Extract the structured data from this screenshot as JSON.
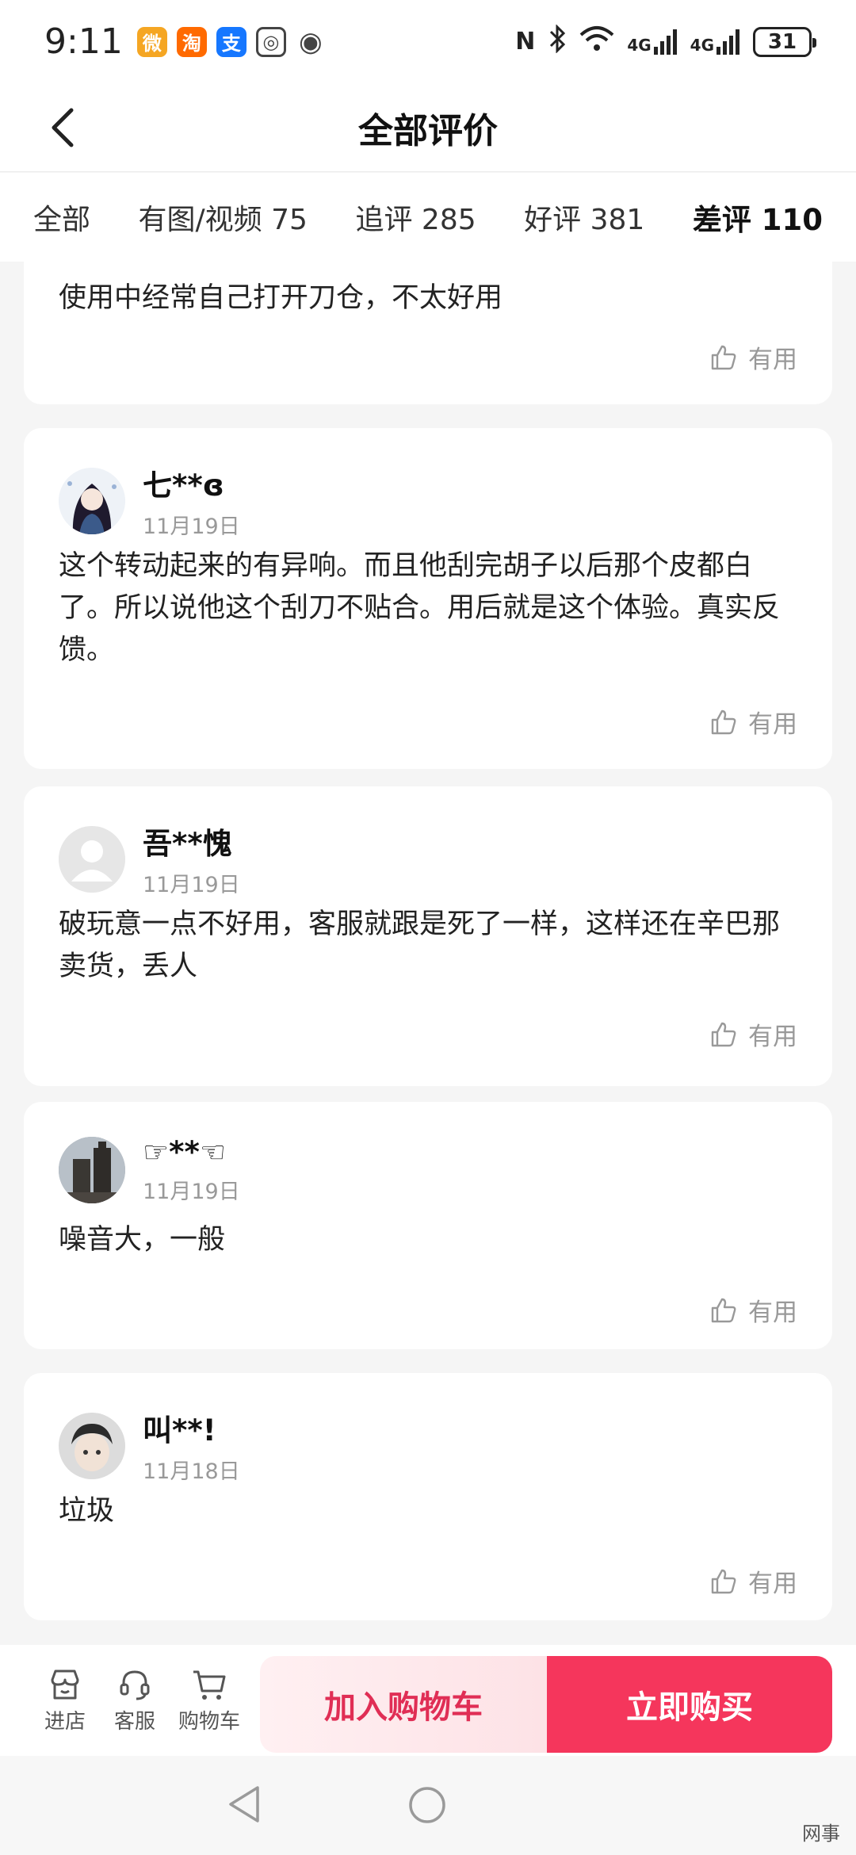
{
  "status_bar": {
    "time": "9:11",
    "apps": [
      {
        "icon": "weibo-icon",
        "color": "#f5a623",
        "glyph": "微"
      },
      {
        "icon": "taobao-icon",
        "color": "#ff6a00",
        "glyph": "淘"
      },
      {
        "icon": "alipay-icon",
        "color": "#1677ff",
        "glyph": "支"
      },
      {
        "icon": "cloud-icon",
        "color": "#444444",
        "glyph": "◎"
      },
      {
        "icon": "eye-icon",
        "color": "#444444",
        "glyph": "◉"
      }
    ],
    "nfc": "N",
    "network1": "4G",
    "network2": "4G",
    "battery": "31"
  },
  "header": {
    "title": "全部评价"
  },
  "tabs": [
    {
      "label": "全部",
      "active": false
    },
    {
      "label": "有图/视频 75",
      "active": false
    },
    {
      "label": "追评 285",
      "active": false
    },
    {
      "label": "好评 381",
      "active": false
    },
    {
      "label": "差评 110",
      "active": true
    }
  ],
  "reviews": [
    {
      "name": "",
      "date": "",
      "content": "使用中经常自己打开刀仓，不太好用",
      "useful_label": "有用",
      "avatar": "none"
    },
    {
      "name": "七**ɞ",
      "date": "11月19日",
      "content": "这个转动起来的有异响。而且他刮完胡子以后那个皮都白了。所以说他这个刮刀不贴合。用后就是这个体验。真实反馈。",
      "useful_label": "有用",
      "avatar": "anime-girl"
    },
    {
      "name": "吾**愧",
      "date": "11月19日",
      "content": "破玩意一点不好用，客服就跟是死了一样，这样还在辛巴那卖货，丢人",
      "useful_label": "有用",
      "avatar": "default"
    },
    {
      "name": "☞**☜",
      "date": "11月19日",
      "content": "噪音大，一般",
      "useful_label": "有用",
      "avatar": "building"
    },
    {
      "name": "叫**!",
      "date": "11月18日",
      "content": "垃圾",
      "useful_label": "有用",
      "avatar": "kid"
    }
  ],
  "bottom_bar": {
    "store_label": "进店",
    "service_label": "客服",
    "cart_label": "购物车",
    "add_to_cart": "加入购物车",
    "buy_now": "立即购买"
  },
  "watermark": "网事",
  "colors": {
    "accent": "#f5365c",
    "accent_text": "#e02e55",
    "cart_bg": "#fde2e6"
  }
}
